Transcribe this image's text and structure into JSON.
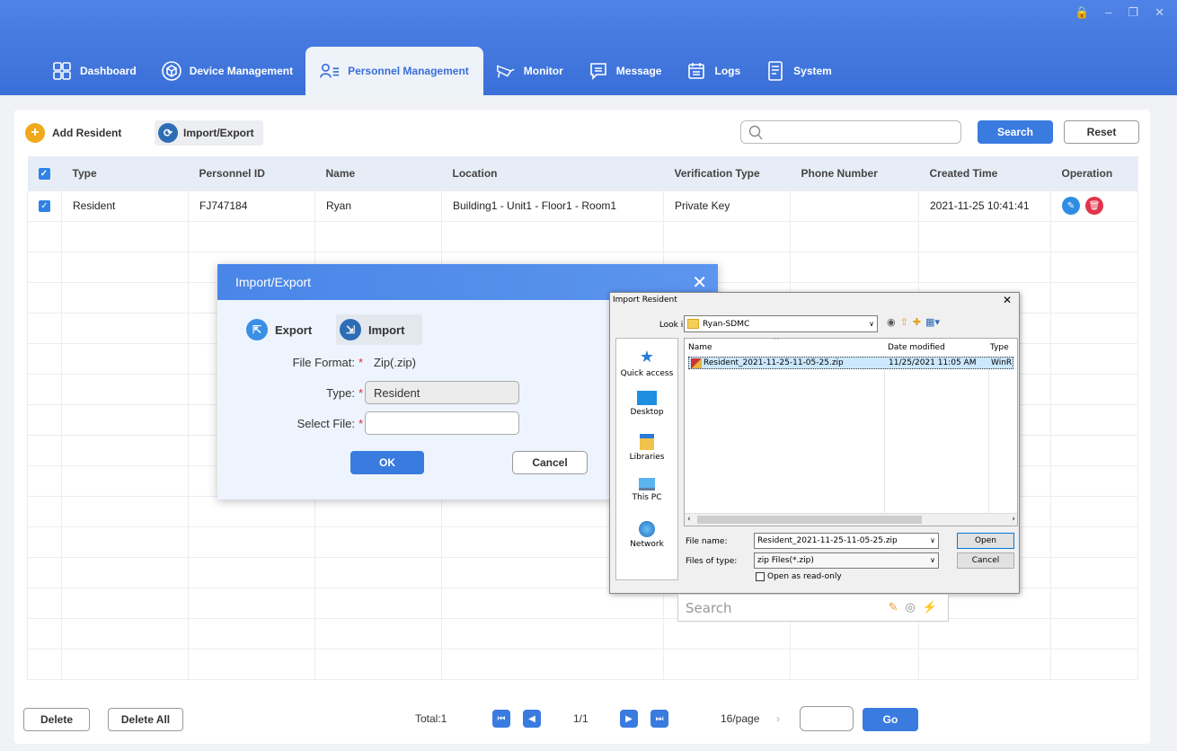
{
  "window_controls": [
    "🔒",
    "–",
    "❐",
    "✕"
  ],
  "nav": {
    "items": [
      {
        "label": "Dashboard",
        "icon": "dashboard-icon"
      },
      {
        "label": "Device Management",
        "icon": "device-box-icon"
      },
      {
        "label": "Personnel Management",
        "icon": "personnel-icon"
      },
      {
        "label": "Monitor",
        "icon": "camera-icon"
      },
      {
        "label": "Message",
        "icon": "message-icon"
      },
      {
        "label": "Logs",
        "icon": "calendar-icon"
      },
      {
        "label": "System",
        "icon": "system-doc-icon"
      }
    ],
    "active": "Personnel Management",
    "active_color": "#3a6fd8"
  },
  "toolbar": {
    "add_label": "Add Resident",
    "import_export_label": "Import/Export",
    "search_placeholder": "",
    "search_label": "Search",
    "reset_label": "Reset"
  },
  "table": {
    "headers": [
      "Type",
      "Personnel ID",
      "Name",
      "Location",
      "Verification Type",
      "Phone Number",
      "Created Time",
      "Operation"
    ],
    "rows": [
      {
        "type": "Resident",
        "id": "FJ747184",
        "name": "Ryan",
        "location": "Building1 - Unit1 - Floor1 - Room1",
        "verification": "Private Key",
        "phone": "",
        "created": "2021-11-25 10:41:41"
      }
    ],
    "empty_rows": 15
  },
  "footer": {
    "delete_label": "Delete",
    "delete_all_label": "Delete All",
    "total": "Total:1",
    "page": "1/1",
    "per_page": "16/page",
    "per_page_arrow": "›",
    "go_label": "Go"
  },
  "import_export_dialog": {
    "title": "Import/Export",
    "close": "✕",
    "tab_export": "Export",
    "tab_import": "Import",
    "active_tab": "Import",
    "file_format_label": "File Format:",
    "file_format_value": "Zip(.zip)",
    "type_label": "Type:",
    "type_value": "Resident",
    "select_file_label": "Select File:",
    "select_file_value": "",
    "required_mark": "*",
    "ok_label": "OK",
    "cancel_label": "Cancel"
  },
  "file_dialog": {
    "title": "Import  Resident",
    "close": "✕",
    "look_in_label": "Look in:",
    "look_in_value": "Ryan-SDMC",
    "places": [
      "Quick access",
      "Desktop",
      "Libraries",
      "This PC",
      "Network"
    ],
    "columns": [
      "Name",
      "Date modified",
      "Type"
    ],
    "files": [
      {
        "name": "Resident_2021-11-25-11-05-25.zip",
        "modified": "11/25/2021 11:05 AM",
        "type": "WinR"
      }
    ],
    "file_name_label": "File name:",
    "file_name_value": "Resident_2021-11-25-11-05-25.zip",
    "files_of_type_label": "Files of type:",
    "files_of_type_value": "zip Files(*.zip)",
    "readonly_label": "Open as read-only",
    "open_label": "Open",
    "cancel_label": "Cancel"
  },
  "search_strip": {
    "placeholder": "Search"
  }
}
